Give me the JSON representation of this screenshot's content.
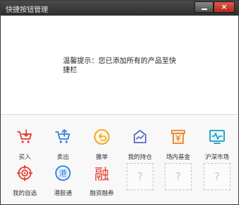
{
  "window": {
    "title": "快捷按钮管理",
    "minimize_icon": "minimize-icon",
    "close_label": "×"
  },
  "message": "温馨提示：您已添加所有的产品至快捷栏",
  "shortcuts": [
    {
      "label": "买入",
      "icon": "cart-down-icon",
      "color": "#e83a2e"
    },
    {
      "label": "卖出",
      "icon": "cart-up-icon",
      "color": "#2f7fd8"
    },
    {
      "label": "撤单",
      "icon": "undo-circle-icon",
      "color": "#f0a21a"
    },
    {
      "label": "我的持仓",
      "icon": "chart-house-icon",
      "color": "#5b69c6"
    },
    {
      "label": "场内基金",
      "icon": "fund-box-icon",
      "color": "#e8842a"
    },
    {
      "label": "沪深市场",
      "icon": "monitor-wave-icon",
      "color": "#1e9ab8"
    },
    {
      "label": "我的自选",
      "icon": "target-icon",
      "color": "#e83a2e"
    },
    {
      "label": "港股通",
      "icon": "hk-circle-icon",
      "color": "#2f7fd8",
      "glyph": "港"
    },
    {
      "label": "融资融券",
      "icon": "rong-icon",
      "color": "#e83a2e",
      "glyph": "融"
    }
  ],
  "empty_slots": [
    "?",
    "?",
    "?"
  ]
}
